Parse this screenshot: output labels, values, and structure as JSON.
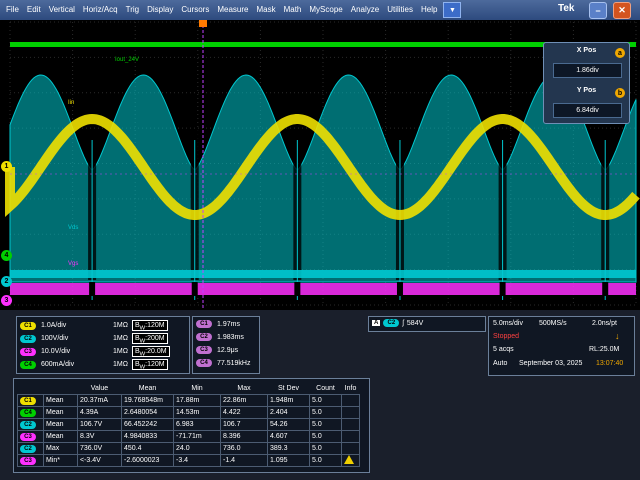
{
  "menu": {
    "items": [
      "File",
      "Edit",
      "Vertical",
      "Horiz/Acq",
      "Trig",
      "Display",
      "Cursors",
      "Measure",
      "Mask",
      "Math",
      "MyScope",
      "Analyze",
      "Utilities",
      "Help"
    ],
    "dropdown_icon": "dropdown-arrow-icon",
    "logo": "Tek",
    "minimize_icon": "minimize-icon",
    "close_icon": "close-icon"
  },
  "waveform_labels": {
    "iout": "Iout_24V",
    "iin": "Iin",
    "vds": "Vds",
    "vgs": "Vgs"
  },
  "channel_markers": [
    "1",
    "4",
    "2",
    "3"
  ],
  "position_panel": {
    "xpos_label": "X Pos",
    "xpos_value": "1.86div",
    "xpos_knob": "a",
    "ypos_label": "Y Pos",
    "ypos_value": "6.84div",
    "ypos_knob": "b"
  },
  "channels": [
    {
      "chip": "C1",
      "scale": "1.0A/div",
      "imp": "1MΩ",
      "bw": "120M",
      "color": "#f0e000"
    },
    {
      "chip": "C2",
      "scale": "100V/div",
      "imp": "1MΩ",
      "bw": "200M",
      "color": "#00c8d0"
    },
    {
      "chip": "C3",
      "scale": "10.0V/div",
      "imp": "1MΩ",
      "bw": "20.0M",
      "color": "#ff30ff"
    },
    {
      "chip": "C4",
      "scale": "600mA/div",
      "imp": "1MΩ",
      "bw": "120M",
      "color": "#00d000"
    }
  ],
  "bw_prefix": "B",
  "bw_subscript": "W",
  "cursors": [
    {
      "chip": "C1",
      "value": "1.97ms"
    },
    {
      "chip": "C2",
      "value": "1.983ms"
    },
    {
      "chip": "C3",
      "value": "12.9μs"
    },
    {
      "chip": "C4",
      "value": "77.519kHz"
    }
  ],
  "trigger": {
    "source_badge": "A",
    "channel": "C2",
    "slope_icon": "rising-edge-icon",
    "slope_glyph": "ʃ",
    "level": "584V"
  },
  "acquisition": {
    "timebase": "5.0ms/div",
    "sample_rate": "500MS/s",
    "resolution": "2.0ns/pt",
    "status": "Stopped",
    "acqs": "5 acqs",
    "record_length": "RL:25.0M",
    "mode": "Auto",
    "date": "September 03, 2025",
    "time": "13:07:40",
    "arrow": "↓"
  },
  "measurements": {
    "headers": [
      "",
      "",
      "Value",
      "Mean",
      "Min",
      "Max",
      "St Dev",
      "Count",
      "Info"
    ],
    "rows": [
      {
        "chip": "C1",
        "type": "Mean",
        "value": "20.37mA",
        "mean": "19.768548m",
        "min": "17.88m",
        "max": "22.86m",
        "stdev": "1.948m",
        "count": "5.0",
        "info": ""
      },
      {
        "chip": "C4",
        "type": "Mean",
        "value": "4.39A",
        "mean": "2.6480054",
        "min": "14.53m",
        "max": "4.422",
        "stdev": "2.404",
        "count": "5.0",
        "info": ""
      },
      {
        "chip": "C2",
        "type": "Mean",
        "value": "106.7V",
        "mean": "66.452242",
        "min": "6.983",
        "max": "106.7",
        "stdev": "54.26",
        "count": "5.0",
        "info": ""
      },
      {
        "chip": "C3",
        "type": "Mean",
        "value": "8.3V",
        "mean": "4.9840833",
        "min": "-71.71m",
        "max": "8.396",
        "stdev": "4.607",
        "count": "5.0",
        "info": ""
      },
      {
        "chip": "C2",
        "type": "Max",
        "value": "736.0V",
        "mean": "450.4",
        "min": "24.0",
        "max": "736.0",
        "stdev": "389.3",
        "count": "5.0",
        "info": ""
      },
      {
        "chip": "C3",
        "type": "Min*",
        "value": "<-3.4V",
        "mean": "-2.6000023",
        "min": "-3.4",
        "max": "-1.4",
        "stdev": "1.095",
        "count": "5.0",
        "info": "warning-icon"
      }
    ]
  },
  "colors": {
    "ch1": "#f0e000",
    "ch2": "#00c8d0",
    "ch3": "#ff30ff",
    "ch4": "#00d000",
    "accent": "#f0a800"
  }
}
